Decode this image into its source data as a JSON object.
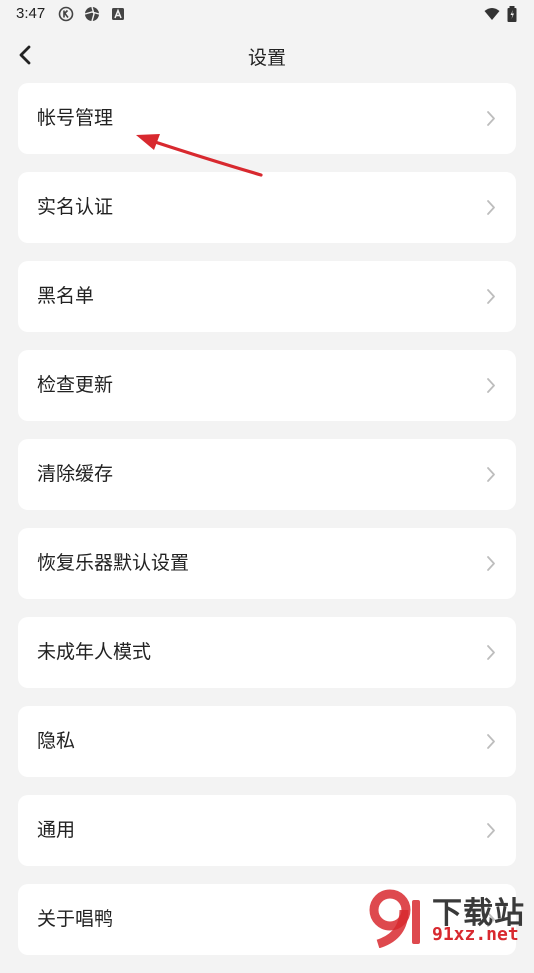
{
  "status_bar": {
    "time": "3:47",
    "icons": [
      "k-circle-icon",
      "aperture-icon",
      "a-box-icon"
    ],
    "right_icons": [
      "wifi-icon",
      "battery-icon"
    ]
  },
  "header": {
    "title": "设置",
    "back_icon": "chevron-left-icon"
  },
  "menu": {
    "items": [
      {
        "label": "帐号管理"
      },
      {
        "label": "实名认证"
      },
      {
        "label": "黑名单"
      },
      {
        "label": "检查更新"
      },
      {
        "label": "清除缓存"
      },
      {
        "label": "恢复乐器默认设置"
      },
      {
        "label": "未成年人模式"
      },
      {
        "label": "隐私"
      },
      {
        "label": "通用"
      },
      {
        "label": "关于唱鸭"
      }
    ]
  },
  "watermark": {
    "text": "下载站",
    "url": "91xz.net",
    "accent_color": "#d8292f"
  },
  "annotation": {
    "arrow_color": "#d8292f"
  }
}
